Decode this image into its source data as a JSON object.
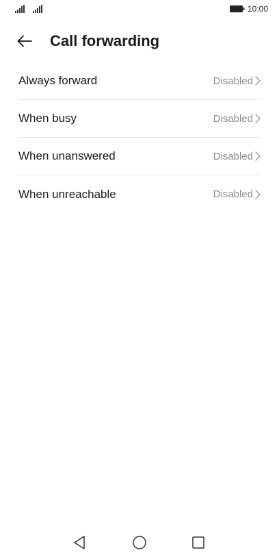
{
  "status_bar": {
    "time": "10:00",
    "icons": [
      "signal-icon",
      "signal-icon",
      "battery-icon"
    ]
  },
  "header": {
    "back_icon": "arrow-left-icon",
    "title": "Call forwarding"
  },
  "items": [
    {
      "label": "Always forward",
      "value": "Disabled"
    },
    {
      "label": "When busy",
      "value": "Disabled"
    },
    {
      "label": "When unanswered",
      "value": "Disabled"
    },
    {
      "label": "When unreachable",
      "value": "Disabled"
    }
  ],
  "nav_bar": {
    "icons": [
      "back-triangle-icon",
      "home-circle-icon",
      "recents-square-icon"
    ]
  },
  "colors": {
    "text": "#1a1a1a",
    "secondary_text": "#8a8a8a",
    "divider": "#e3e3e3",
    "background": "#ffffff"
  }
}
